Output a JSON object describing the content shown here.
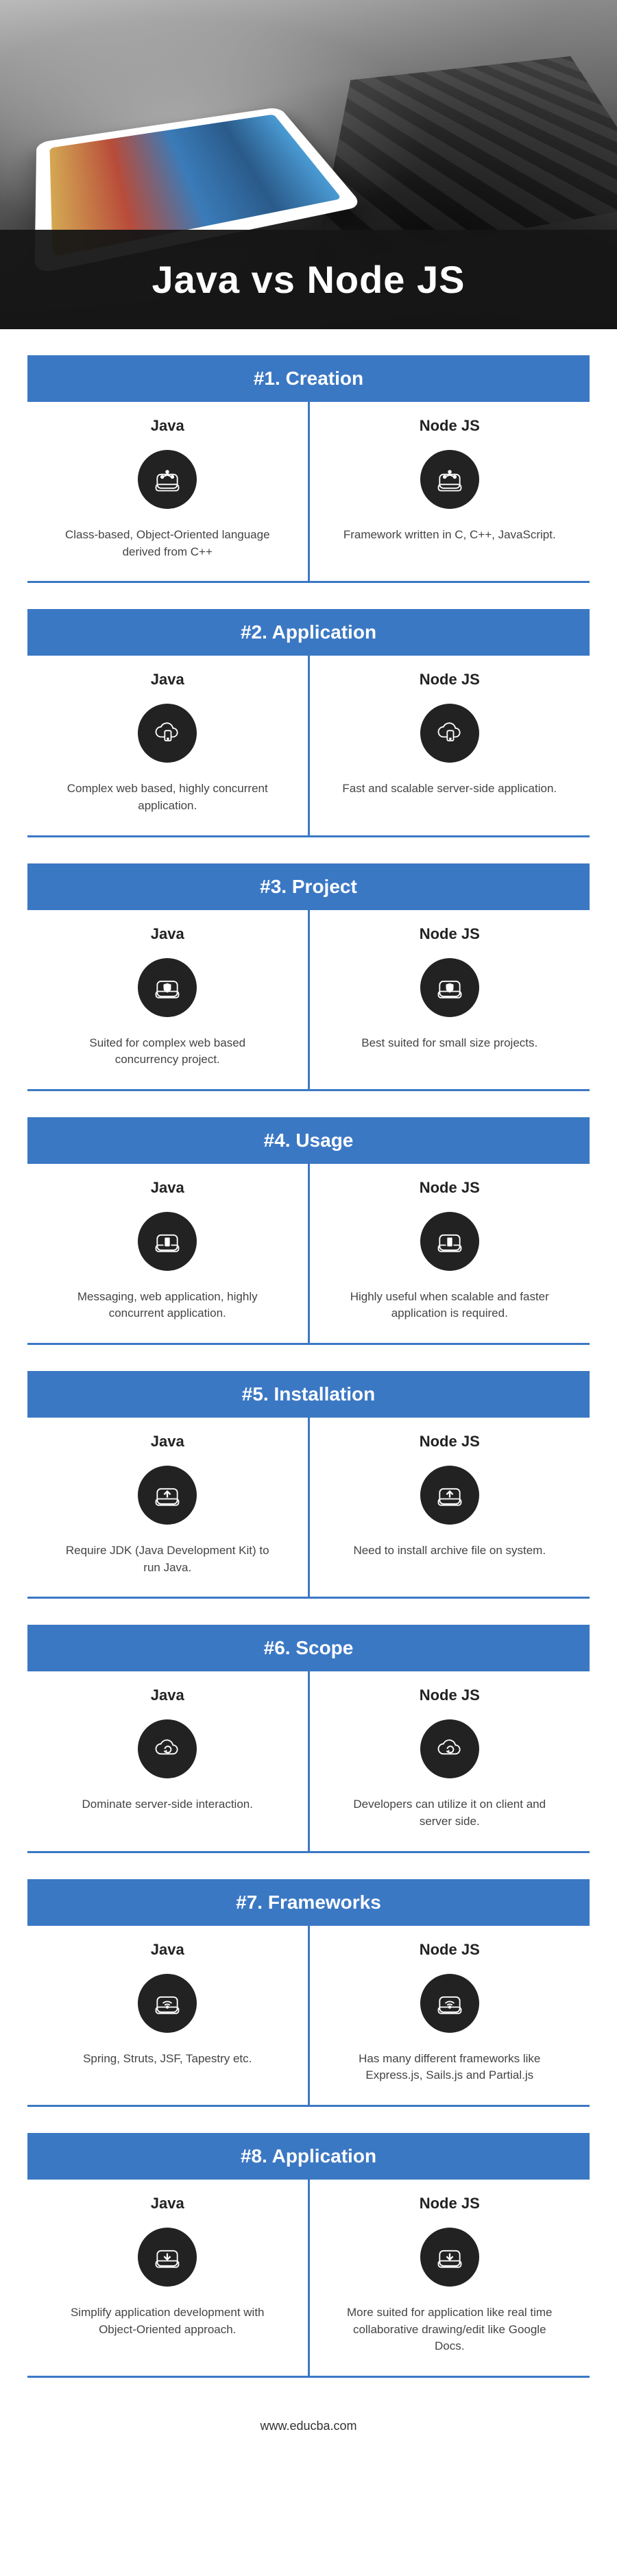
{
  "hero": {
    "title": "Java vs Node JS"
  },
  "columns": {
    "left_label": "Java",
    "right_label": "Node JS"
  },
  "sections": [
    {
      "header": "#1. Creation",
      "icon": "hdd-tree",
      "java": "Class-based, Object-Oriented language derived from C++",
      "node": "Framework written in C, C++, JavaScript."
    },
    {
      "header": "#2. Application",
      "icon": "cloud-phone",
      "java": "Complex web based, highly concurrent application.",
      "node": "Fast and scalable server-side application."
    },
    {
      "header": "#3. Project",
      "icon": "hdd-shield",
      "java": "Suited for complex web based concurrency project.",
      "node": "Best suited for small size projects."
    },
    {
      "header": "#4. Usage",
      "icon": "hdd-phone",
      "java": "Messaging, web application, highly concurrent application.",
      "node": "Highly useful when scalable and faster application is required."
    },
    {
      "header": "#5. Installation",
      "icon": "hdd-upload",
      "java": "Require JDK (Java Development Kit) to run Java.",
      "node": "Need to install archive file on system."
    },
    {
      "header": "#6. Scope",
      "icon": "cloud-refresh",
      "java": "Dominate server-side interaction.",
      "node": "Developers can utilize it on client and server side."
    },
    {
      "header": "#7. Frameworks",
      "icon": "hdd-wifi",
      "java": "Spring, Struts, JSF, Tapestry etc.",
      "node": "Has many different frameworks like Express.js, Sails.js and Partial.js"
    },
    {
      "header": "#8. Application",
      "icon": "hdd-download",
      "java": "Simplify application development with Object-Oriented approach.",
      "node": "More suited for application like real time collaborative drawing/edit like Google Docs."
    }
  ],
  "footer": {
    "url": "www.educba.com"
  }
}
